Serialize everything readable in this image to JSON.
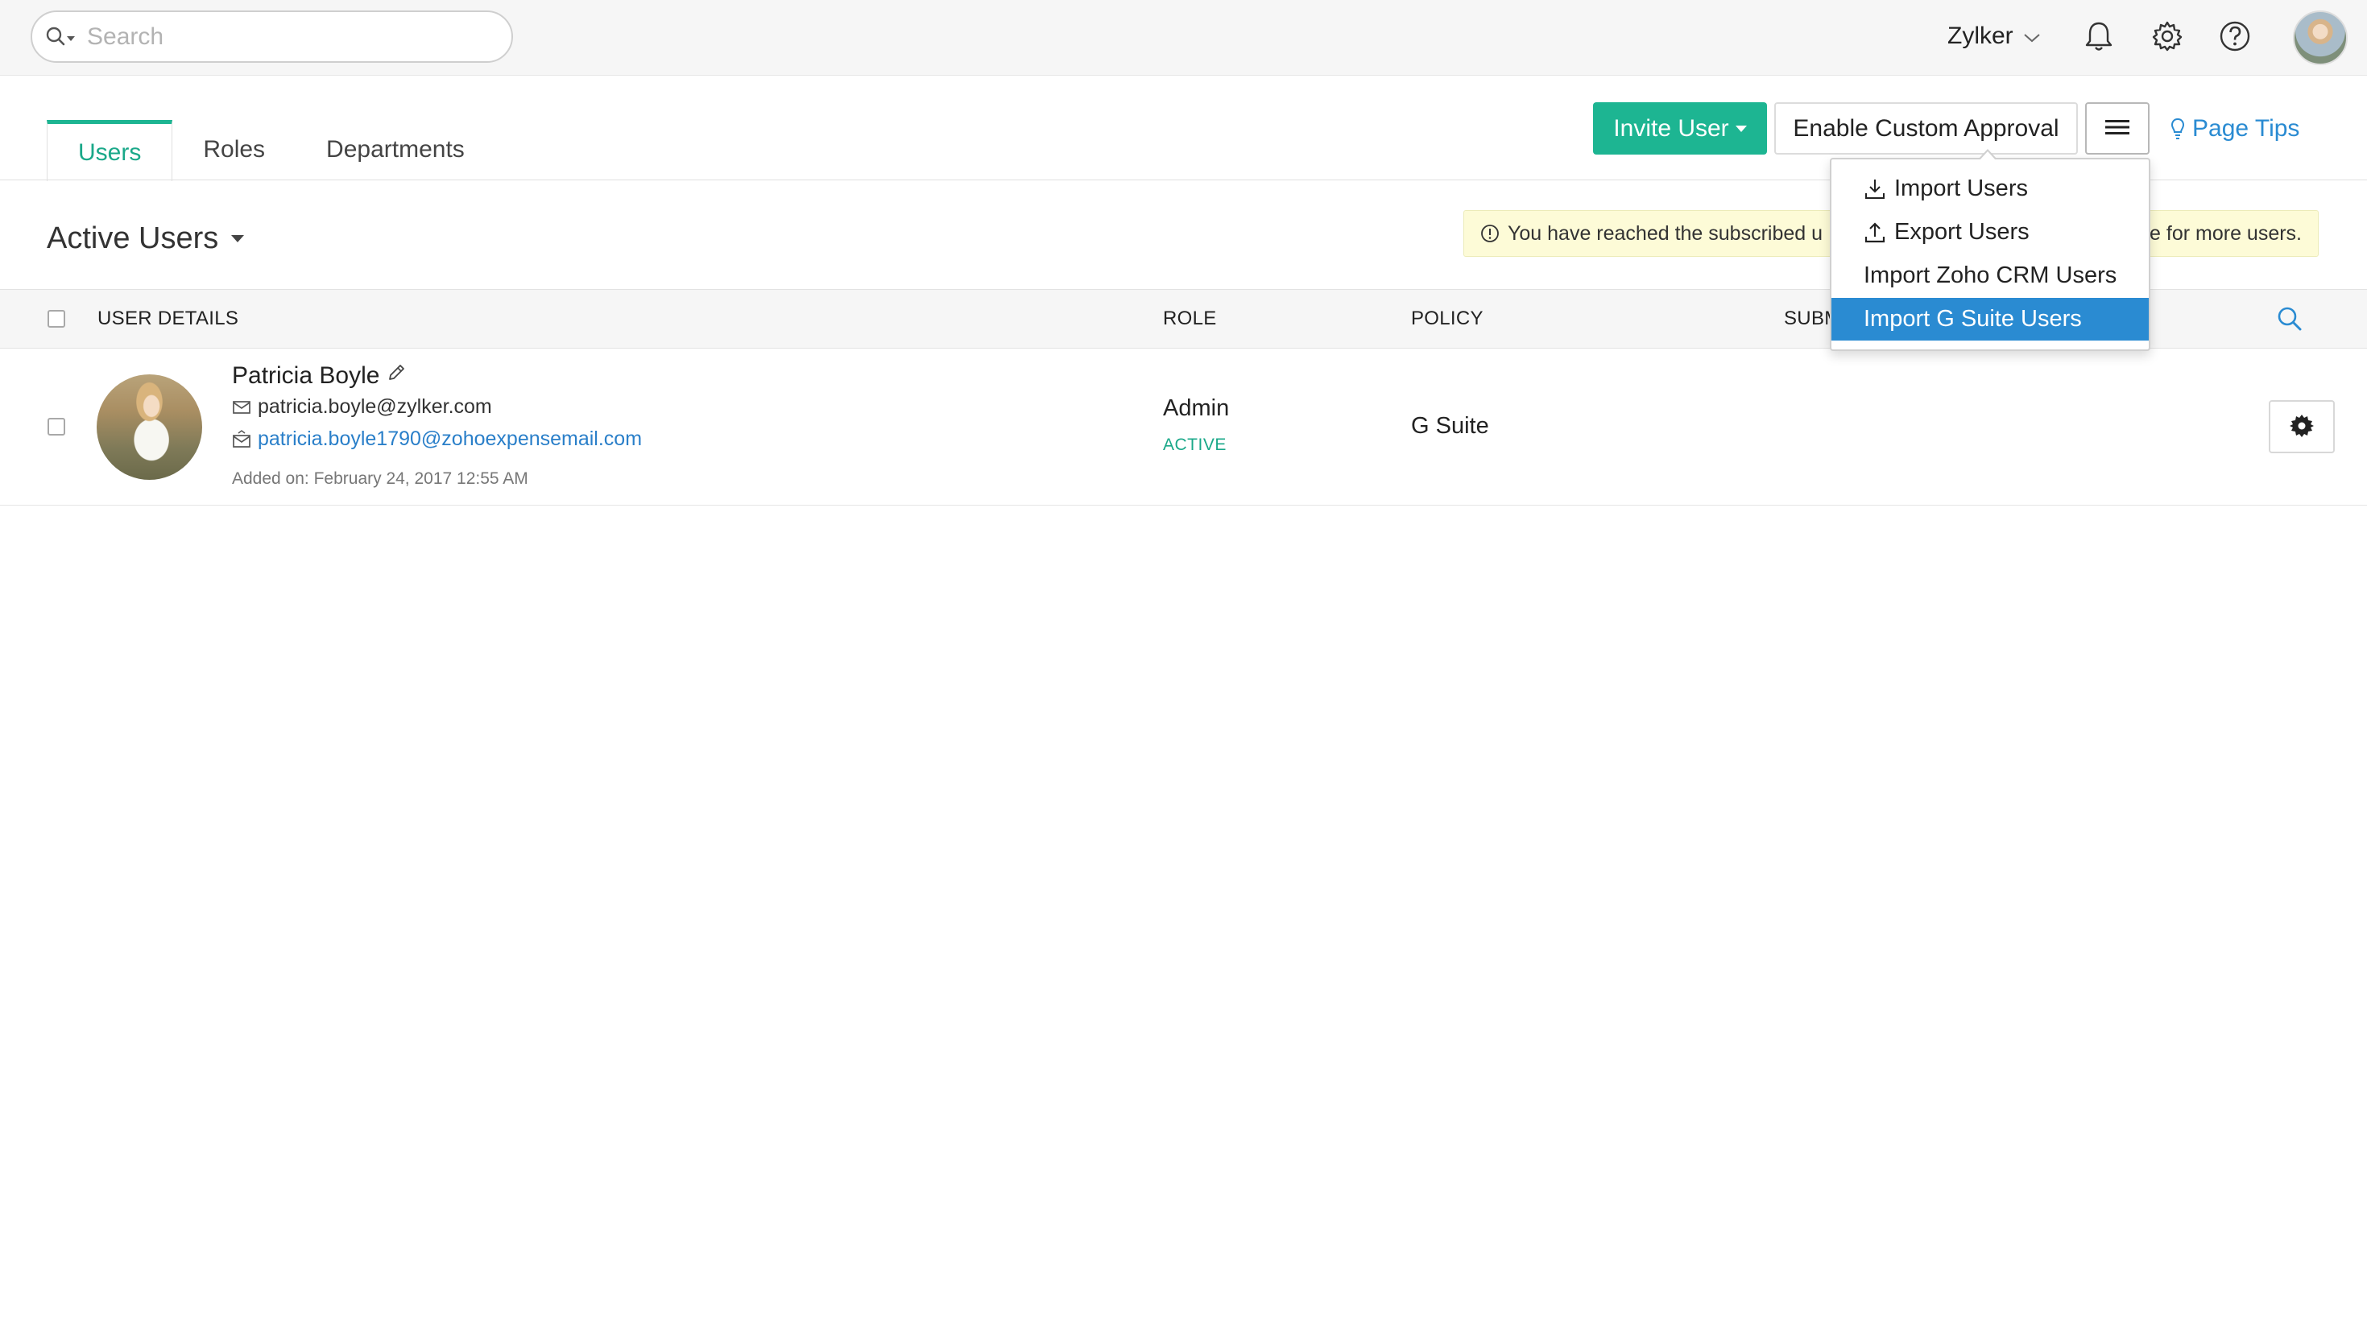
{
  "search": {
    "placeholder": "Search",
    "icon": "search-icon"
  },
  "header": {
    "org_name": "Zylker"
  },
  "tabs": [
    {
      "label": "Users",
      "active": true
    },
    {
      "label": "Roles",
      "active": false
    },
    {
      "label": "Departments",
      "active": false
    }
  ],
  "toolbar": {
    "invite_label": "Invite User",
    "approval_label": "Enable Custom Approval",
    "page_tips_label": "Page Tips"
  },
  "menu": {
    "items": [
      {
        "label": "Import Users",
        "icon": "download-icon"
      },
      {
        "label": "Export Users",
        "icon": "upload-icon"
      },
      {
        "label": "Import Zoho CRM Users",
        "icon": ""
      },
      {
        "label": "Import G Suite Users",
        "icon": "",
        "highlighted": true
      }
    ]
  },
  "view": {
    "title": "Active Users"
  },
  "notice": {
    "text_left": "You have reached the subscribed u",
    "text_right": "e for more users."
  },
  "table": {
    "headers": {
      "user_details": "USER DETAILS",
      "role": "ROLE",
      "policy": "POLICY",
      "submitter": "SUBM"
    },
    "rows": [
      {
        "name": "Patricia Boyle",
        "email": "patricia.boyle@zylker.com",
        "forward_email": "patricia.boyle1790@zohoexpensemail.com",
        "added_on": "Added on: February 24, 2017 12:55 AM",
        "role": "Admin",
        "status": "ACTIVE",
        "policy": "G Suite"
      }
    ]
  },
  "colors": {
    "accent": "#1db592",
    "link": "#2a8bd2",
    "menu_highlight": "#2a8bd2",
    "notice_bg": "#fdfbd7"
  }
}
